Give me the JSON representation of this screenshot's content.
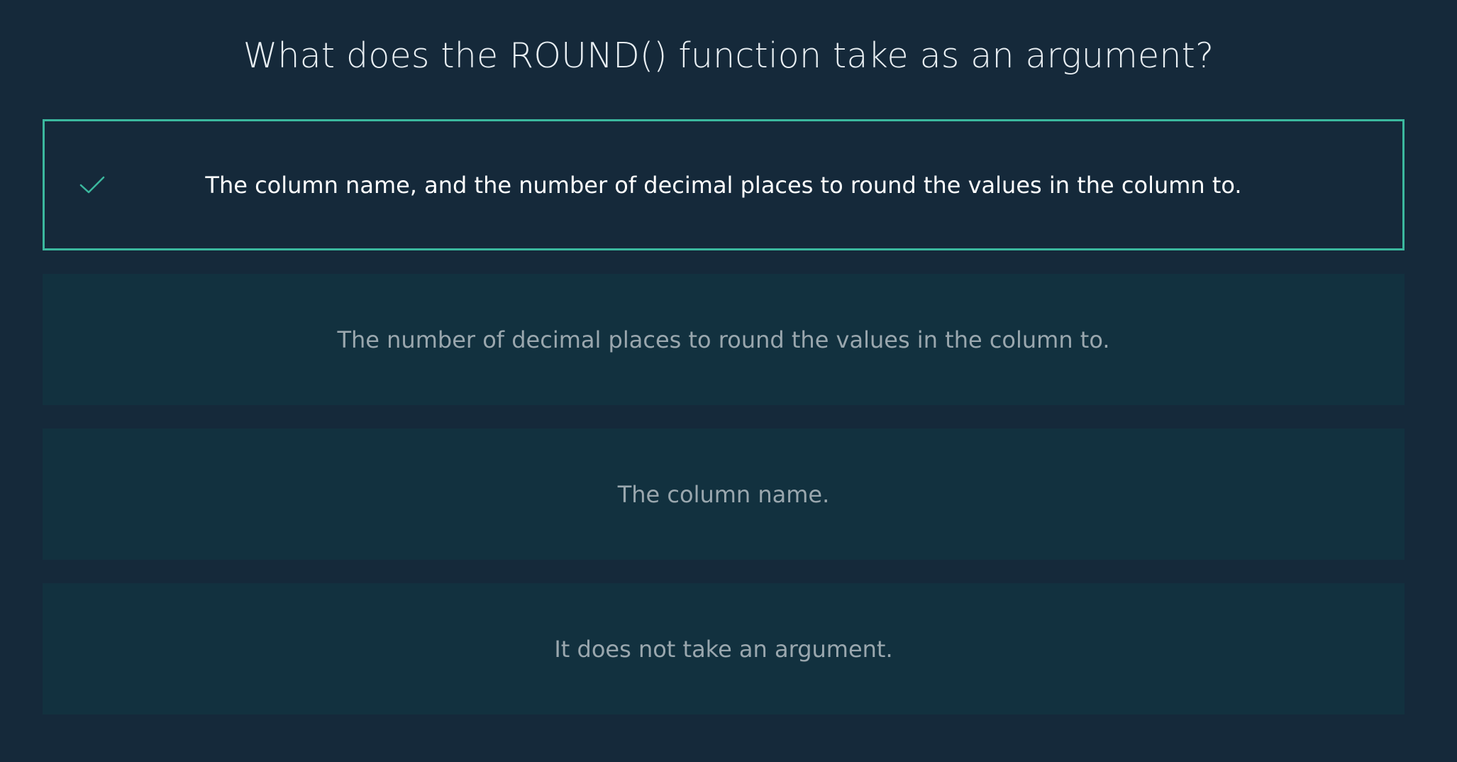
{
  "quiz": {
    "question": "What does the ROUND() function take as an argument?",
    "options": [
      {
        "label": "The column name, and the number of decimal places to round the values in the column to.",
        "selected": true
      },
      {
        "label": "The number of decimal places to round the values in the column to.",
        "selected": false
      },
      {
        "label": "The column name.",
        "selected": false
      },
      {
        "label": "It does not take an argument.",
        "selected": false
      }
    ]
  },
  "icons": {
    "selected_marker": "check-icon"
  },
  "colors": {
    "background": "#15293a",
    "option_background": "#12313f",
    "accent": "#3bb89e",
    "question_text": "#e8eef2",
    "option_text": "#9aa7ae",
    "selected_text": "#ffffff"
  }
}
